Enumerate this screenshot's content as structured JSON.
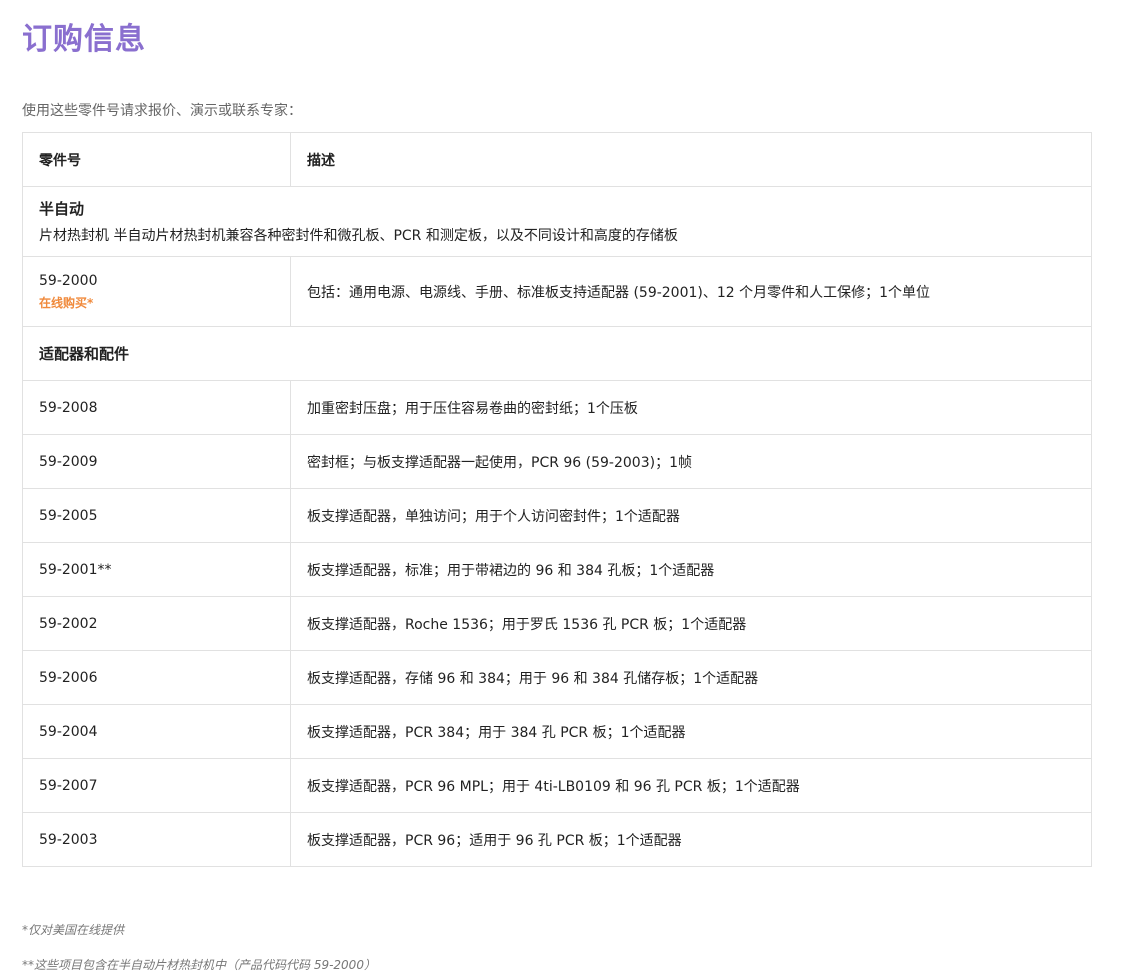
{
  "page": {
    "title": "订购信息",
    "intro": "使用这些零件号请求报价、演示或联系专家："
  },
  "table": {
    "headers": {
      "part": "零件号",
      "description": "描述"
    },
    "section1": {
      "title": "半自动",
      "description": "片材热封机 半自动片材热封机兼容各种密封件和微孔板、PCR 和测定板，以及不同设计和高度的存储板"
    },
    "featured": {
      "part": "59-2000",
      "buy_label": "在线购买*",
      "description": "包括：通用电源、电源线、手册、标准板支持适配器 (59-2001)、12 个月零件和人工保修；1个单位"
    },
    "section2": {
      "title": "适配器和配件"
    },
    "rows": [
      {
        "part": "59-2008",
        "description": "加重密封压盘；用于压住容易卷曲的密封纸；1个压板"
      },
      {
        "part": "59-2009",
        "description": "密封框；与板支撑适配器一起使用，PCR 96 (59-2003)；1帧"
      },
      {
        "part": "59-2005",
        "description": "板支撑适配器，单独访问；用于个人访问密封件；1个适配器"
      },
      {
        "part": "59-2001**",
        "description": "板支撑适配器，标准；用于带裙边的 96 和 384 孔板；1个适配器"
      },
      {
        "part": "59-2002",
        "description": "板支撑适配器，Roche 1536；用于罗氏 1536 孔 PCR 板；1个适配器"
      },
      {
        "part": "59-2006",
        "description": "板支撑适配器，存储 96 和 384；用于 96 和 384 孔储存板；1个适配器"
      },
      {
        "part": "59-2004",
        "description": "板支撑适配器，PCR 384；用于 384 孔 PCR 板；1个适配器"
      },
      {
        "part": "59-2007",
        "description": "板支撑适配器，PCR 96 MPL；用于 4ti-LB0109 和 96 孔 PCR 板；1个适配器"
      },
      {
        "part": "59-2003",
        "description": "板支撑适配器，PCR 96；适用于 96 孔 PCR 板；1个适配器"
      }
    ]
  },
  "footnotes": {
    "note1": "*仅对美国在线提供",
    "note2": "**这些项目包含在半自动片材热封机中（产品代码代码 59-2000）"
  }
}
